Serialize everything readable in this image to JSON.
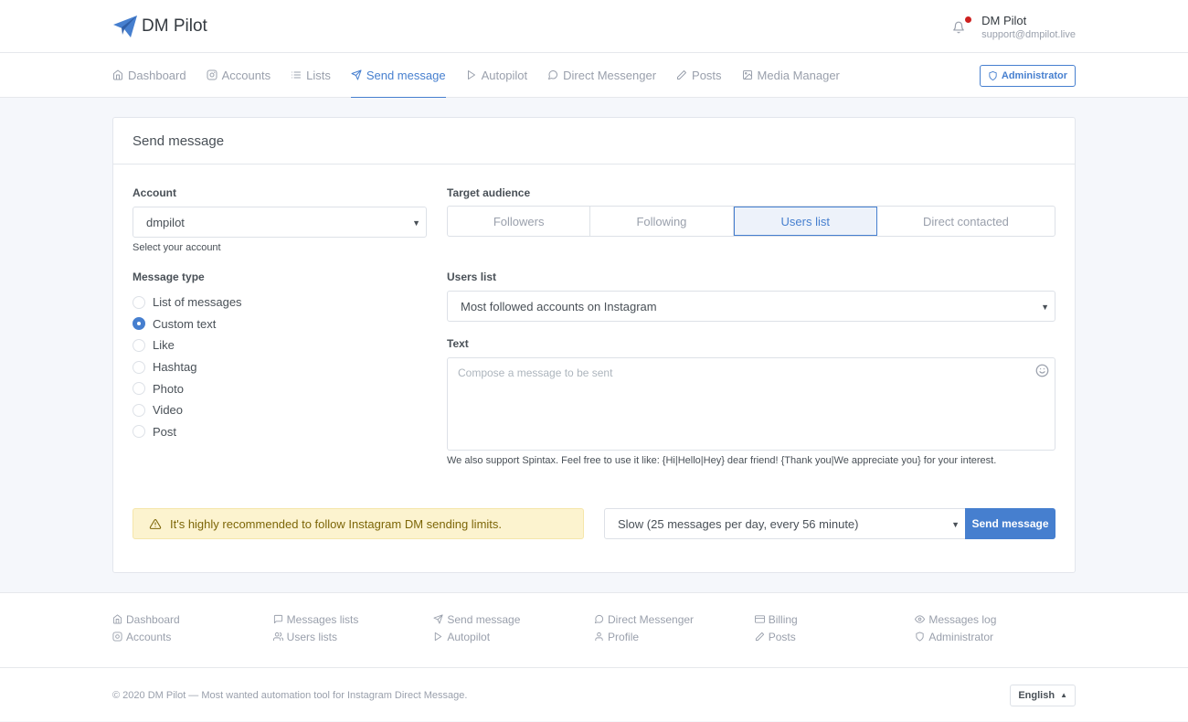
{
  "app": {
    "brand": "DM Pilot",
    "accent": "#467fcf"
  },
  "user": {
    "name": "DM Pilot",
    "email": "support@dmpilot.live",
    "notification_dot": "#cd201f"
  },
  "nav": {
    "items": [
      {
        "label": "Dashboard",
        "icon": "home-icon"
      },
      {
        "label": "Accounts",
        "icon": "instagram-icon"
      },
      {
        "label": "Lists",
        "icon": "list-icon"
      },
      {
        "label": "Send message",
        "icon": "send-icon",
        "active": true
      },
      {
        "label": "Autopilot",
        "icon": "play-icon"
      },
      {
        "label": "Direct Messenger",
        "icon": "message-circle-icon"
      },
      {
        "label": "Posts",
        "icon": "edit-icon"
      },
      {
        "label": "Media Manager",
        "icon": "image-icon"
      }
    ],
    "admin_label": "Administrator"
  },
  "card": {
    "title": "Send message",
    "account": {
      "label": "Account",
      "value": "dmpilot",
      "hint": "Select your account"
    },
    "message_type": {
      "label": "Message type",
      "options": [
        "List of messages",
        "Custom text",
        "Like",
        "Hashtag",
        "Photo",
        "Video",
        "Post"
      ],
      "selected": "Custom text"
    },
    "target_audience": {
      "label": "Target audience",
      "options": [
        "Followers",
        "Following",
        "Users list",
        "Direct contacted"
      ],
      "selected": "Users list"
    },
    "users_list": {
      "label": "Users list",
      "value": "Most followed accounts on Instagram"
    },
    "text": {
      "label": "Text",
      "placeholder": "Compose a message to be sent",
      "hint": "We also support Spintax. Feel free to use it like: {Hi|Hello|Hey} dear friend! {Thank you|We appreciate you} for your interest."
    },
    "alert": "It's highly recommended to follow Instagram DM sending limits.",
    "speed": "Slow (25 messages per day, every 56 minute)",
    "send_label": "Send message"
  },
  "footer_links": {
    "columns": [
      [
        {
          "label": "Dashboard",
          "icon": "home-icon"
        },
        {
          "label": "Accounts",
          "icon": "instagram-icon"
        }
      ],
      [
        {
          "label": "Messages lists",
          "icon": "message-square-icon"
        },
        {
          "label": "Users lists",
          "icon": "users-icon"
        }
      ],
      [
        {
          "label": "Send message",
          "icon": "send-icon"
        },
        {
          "label": "Autopilot",
          "icon": "play-icon"
        }
      ],
      [
        {
          "label": "Direct Messenger",
          "icon": "message-circle-icon"
        },
        {
          "label": "Profile",
          "icon": "user-icon"
        }
      ],
      [
        {
          "label": "Billing",
          "icon": "credit-card-icon"
        },
        {
          "label": "Posts",
          "icon": "edit-icon"
        }
      ],
      [
        {
          "label": "Messages log",
          "icon": "eye-icon"
        },
        {
          "label": "Administrator",
          "icon": "shield-icon"
        }
      ]
    ]
  },
  "footer": {
    "copyright": "© 2020 DM Pilot — Most wanted automation tool for Instagram Direct Message.",
    "language": "English"
  }
}
